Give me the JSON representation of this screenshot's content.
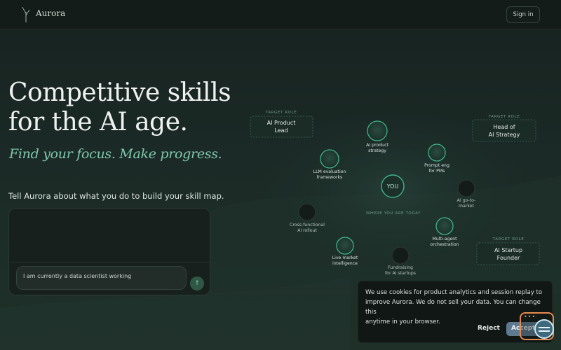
{
  "header": {
    "brand": "Aurora",
    "sign_in_label": "Sign in"
  },
  "hero": {
    "title_line1": "Competitive skills",
    "title_line2": "for the AI age.",
    "tagline": "Find your focus. Make progress.",
    "prompt": "Tell Aurora about what you do to build your skill map."
  },
  "chat": {
    "input_value": "I am currently a data scientist working",
    "send_icon": "arrow-up-icon"
  },
  "skill_map": {
    "caption": "WHERE YOU ARE TODAY",
    "you_label": "YOU",
    "targets": [
      {
        "eyebrow": "TARGET ROLE",
        "line1": "AI Product",
        "line2": "Lead"
      },
      {
        "eyebrow": "TARGET ROLE",
        "line1": "Head of",
        "line2": "AI Strategy"
      },
      {
        "eyebrow": "TARGET ROLE",
        "line1": "AI Startup",
        "line2": "Founder"
      }
    ],
    "nodes": [
      {
        "line1": "AI product",
        "line2": "strategy",
        "state": "active"
      },
      {
        "line1": "LLM evaluation",
        "line2": "frameworks",
        "state": "active"
      },
      {
        "line1": "Prompt eng",
        "line2": "for PMs",
        "state": "active"
      },
      {
        "line1": "AI go-to-",
        "line2": "market",
        "state": "inactive"
      },
      {
        "line1": "Cross-functional",
        "line2": "AI rollout",
        "state": "inactive"
      },
      {
        "line1": "Multi-agent",
        "line2": "orchestration",
        "state": "active"
      },
      {
        "line1": "Live market",
        "line2": "intelligence",
        "state": "active"
      },
      {
        "line1": "Fundraising",
        "line2": "for AI startups",
        "state": "inactive"
      }
    ]
  },
  "cookie_banner": {
    "line1": "We use cookies for product analytics and session replay to",
    "line2": "improve Aurora. We do not sell your data. You can change this",
    "line3": "anytime in your browser.",
    "reject_label": "Reject",
    "accept_label": "Accept"
  },
  "colors": {
    "accent": "#7fc8ac",
    "node_active": "#3fb58a",
    "background": "#1b2a26"
  },
  "icons": {
    "logo": "sprout-icon",
    "widget": "chat-widget-icon"
  }
}
